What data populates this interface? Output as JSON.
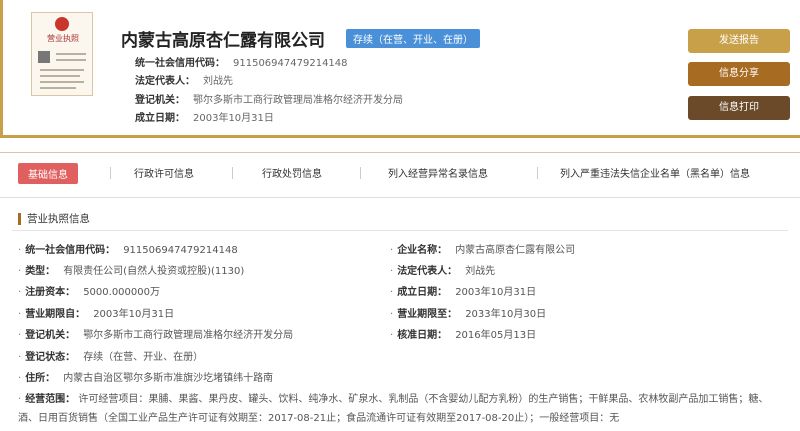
{
  "header": {
    "license_thumb_title": "营业执照",
    "company_name": "内蒙古高原杏仁露有限公司",
    "status_tag": "存续（在营、开业、在册）",
    "rows": [
      {
        "label": "统一社会信用代码：",
        "value": "911506947479214148"
      },
      {
        "label": "法定代表人：",
        "value": "刘战先"
      },
      {
        "label": "登记机关：",
        "value": "鄂尔多斯市工商行政管理局准格尔经济开发分局"
      },
      {
        "label": "成立日期：",
        "value": "2003年10月31日"
      }
    ],
    "buttons": {
      "report": "发送报告",
      "share": "信息分享",
      "print": "信息打印"
    }
  },
  "tabs": [
    "基础信息",
    "行政许可信息",
    "行政处罚信息",
    "列入经营异常名录信息",
    "列入严重违法失信企业名单（黑名单）信息"
  ],
  "section_title": "营业执照信息",
  "fields_left": [
    {
      "label": "统一社会信用代码：",
      "value": "911506947479214148"
    },
    {
      "label": "类型：",
      "value": "有限责任公司(自然人投资或控股)(1130)"
    },
    {
      "label": "注册资本：",
      "value": "5000.000000万"
    },
    {
      "label": "营业期限自：",
      "value": "2003年10月31日"
    },
    {
      "label": "登记机关：",
      "value": "鄂尔多斯市工商行政管理局准格尔经济开发分局"
    },
    {
      "label": "登记状态：",
      "value": "存续（在营、开业、在册）"
    },
    {
      "label": "住所：",
      "value": "内蒙古自治区鄂尔多斯市准旗沙圪堵镇纬十路南"
    }
  ],
  "fields_right": [
    {
      "label": "企业名称：",
      "value": "内蒙古高原杏仁露有限公司"
    },
    {
      "label": "法定代表人：",
      "value": "刘战先"
    },
    {
      "label": "成立日期：",
      "value": "2003年10月31日"
    },
    {
      "label": "营业期限至：",
      "value": "2033年10月30日"
    },
    {
      "label": "核准日期：",
      "value": "2016年05月13日"
    }
  ],
  "scope": {
    "label": "经营范围：",
    "value": "许可经营项目：果脯、果酱、果丹皮、罐头、饮料、纯净水、矿泉水、乳制品（不含婴幼儿配方乳粉）的生产销售；干鲜果品、农林牧副产品加工销售；糖、酒、日用百货销售（全国工业产品生产许可证有效期至：2017-08-21止；食品流通许可证有效期至2017-08-20止）；一般经营项目：无"
  },
  "bullet": "·"
}
